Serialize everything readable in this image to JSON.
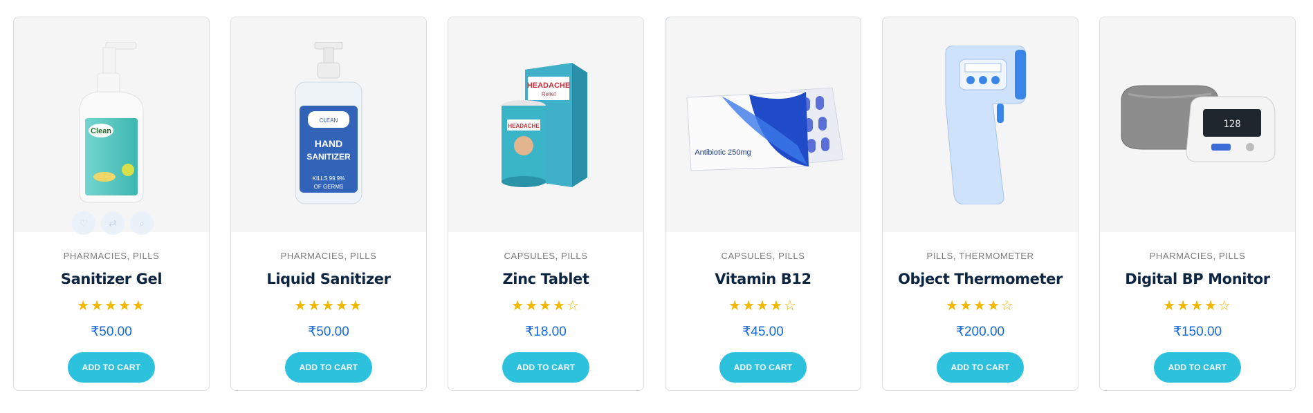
{
  "products": [
    {
      "categories": "PHARMACIES, PILLS",
      "name": "Sanitizer Gel",
      "rating": 5,
      "price": "₹50.00",
      "cta": "ADD TO CART",
      "image_icon": "sanitizer-gel-bottle"
    },
    {
      "categories": "PHARMACIES, PILLS",
      "name": "Liquid Sanitizer",
      "rating": 5,
      "price": "₹50.00",
      "cta": "ADD TO CART",
      "image_icon": "hand-sanitizer-pump"
    },
    {
      "categories": "CAPSULES, PILLS",
      "name": "Zinc Tablet",
      "rating": 4,
      "price": "₹18.00",
      "cta": "ADD TO CART",
      "image_icon": "headache-relief-box"
    },
    {
      "categories": "CAPSULES, PILLS",
      "name": "Vitamin B12",
      "rating": 4,
      "price": "₹45.00",
      "cta": "ADD TO CART",
      "image_icon": "antibiotic-blister-pack",
      "image_text": "Antibiotic 250mg"
    },
    {
      "categories": "PILLS, THERMOMETER",
      "name": "Object Thermometer",
      "rating": 4,
      "price": "₹200.00",
      "cta": "ADD TO CART",
      "image_icon": "infrared-thermometer"
    },
    {
      "categories": "PHARMACIES, PILLS",
      "name": "Digital BP Monitor",
      "rating": 4,
      "price": "₹150.00",
      "cta": "ADD TO CART",
      "image_icon": "bp-monitor"
    }
  ],
  "colors": {
    "accent": "#2cc1dd",
    "price": "#1669d9",
    "star": "#f3b700",
    "title": "#0d2540",
    "pin": "#1669d9"
  },
  "badges": {
    "featured_pin_icon": "pin-icon"
  },
  "quick_actions": [
    "heart-icon",
    "shuffle-icon",
    "search-icon"
  ]
}
